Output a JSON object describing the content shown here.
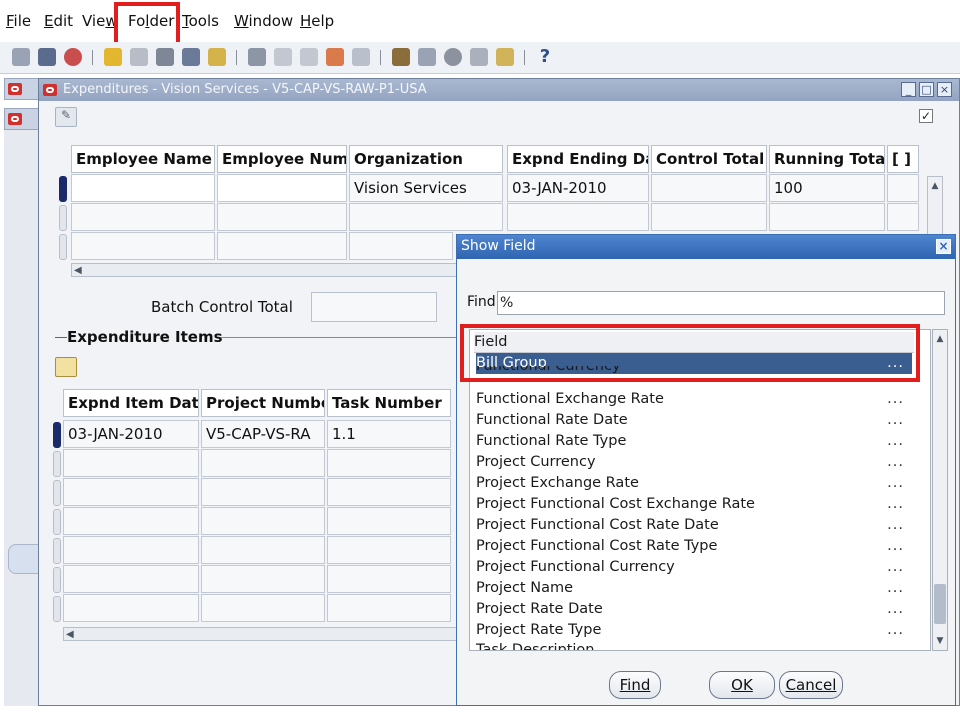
{
  "menubar": {
    "items": [
      {
        "label": "File",
        "key": "file"
      },
      {
        "label": "Edit",
        "key": "edit"
      },
      {
        "label": "View",
        "key": "view"
      },
      {
        "label": "Folder",
        "key": "folder"
      },
      {
        "label": "Tools",
        "key": "tools"
      },
      {
        "label": "Window",
        "key": "window"
      },
      {
        "label": "Help",
        "key": "help"
      }
    ]
  },
  "main_window": {
    "title": "Expenditures - Vision Services - V5-CAP-VS-RAW-P1-USA",
    "header_columns": [
      "Employee Name",
      "Employee Numb",
      "Organization",
      "Expnd Ending Dat",
      "Control Total",
      "Running Total",
      "[ ]"
    ],
    "header_row": {
      "organization": "Vision Services",
      "expnd_ending_date": "03-JAN-2010",
      "running_total": "100"
    },
    "batch_control_total_label": "Batch Control Total",
    "items_section_label": "Expenditure Items",
    "items_columns": [
      "Expnd Item Date",
      "Project Number",
      "Task Number"
    ],
    "items_row": {
      "expnd_item_date": "03-JAN-2010",
      "project_number": "V5-CAP-VS-RA",
      "task_number": "1.1"
    }
  },
  "show_field_dialog": {
    "title": "Show Field",
    "find_label": "Find",
    "find_value": "%",
    "list_header": "Field",
    "selected_item": "Bill Group",
    "items": [
      "Functional Currency",
      "Functional Exchange Rate",
      "Functional Rate Date",
      "Functional Rate Type",
      "Project Currency",
      "Project Exchange Rate",
      "Project Functional Cost Exchange Rate",
      "Project Functional Cost Rate Date",
      "Project Functional Cost Rate Type",
      "Project Functional Currency",
      "Project Name",
      "Project Rate Date",
      "Project Rate Type",
      "Task Description"
    ],
    "ellipsis": "...",
    "buttons": {
      "find": "Find",
      "ok": "OK",
      "cancel": "Cancel"
    }
  },
  "status_bar": {
    "text": ""
  },
  "colors": {
    "highlight": "#e01e1e",
    "selection": "#3b5e91",
    "dialog_title": "#2f64b1"
  }
}
